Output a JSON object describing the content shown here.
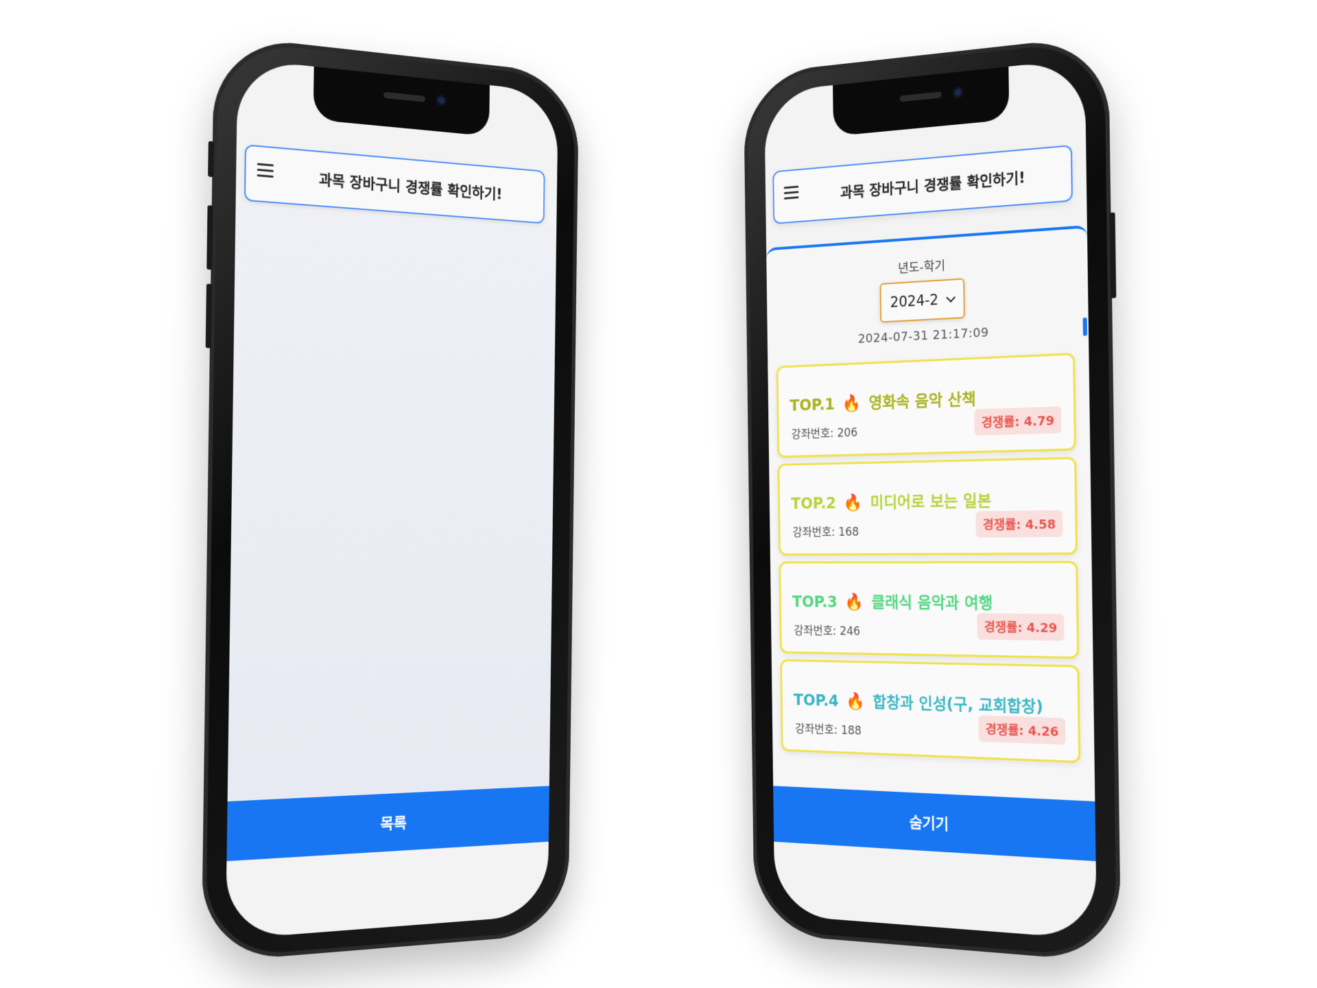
{
  "left_phone": {
    "app_bar": {
      "title": "과목 장바구니 경쟁률 확인하기!",
      "menu_icon": "hamburger-menu-icon"
    },
    "bottom_button": {
      "label": "목록"
    }
  },
  "right_phone": {
    "app_bar": {
      "title": "과목 장바구니 경쟁률 확인하기!",
      "menu_icon": "hamburger-menu-icon"
    },
    "semester": {
      "label": "년도-학기",
      "selected": "2024-2"
    },
    "timestamp": "2024-07-31 21:17:09",
    "rankings": [
      {
        "rank": "TOP.1",
        "icon": "fire-icon",
        "course": "영화속 음악 산책",
        "lecture_label": "강좌번호: 206",
        "rate_label": "경쟁률: 4.79",
        "color": "#a8b21e"
      },
      {
        "rank": "TOP.2",
        "icon": "fire-icon",
        "course": "미디어로 보는 일본",
        "lecture_label": "강좌번호: 168",
        "rate_label": "경쟁률: 4.58",
        "color": "#b6d33a"
      },
      {
        "rank": "TOP.3",
        "icon": "fire-icon",
        "course": "클래식 음악과 여행",
        "lecture_label": "강좌번호: 246",
        "rate_label": "경쟁률: 4.29",
        "color": "#52d682"
      },
      {
        "rank": "TOP.4",
        "icon": "fire-icon",
        "course": "합창과 인성(구, 교회합창)",
        "lecture_label": "강좌번호: 188",
        "rate_label": "경쟁률: 4.26",
        "color": "#39b5c4"
      }
    ],
    "bottom_button": {
      "label": "숨기기"
    }
  }
}
